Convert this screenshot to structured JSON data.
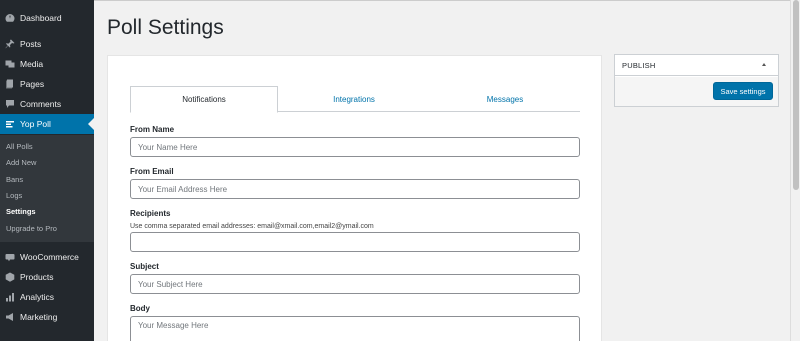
{
  "sidebar": {
    "items": [
      {
        "label": "Dashboard",
        "icon": "dashboard-icon"
      },
      {
        "label": "Posts",
        "icon": "pin-icon"
      },
      {
        "label": "Media",
        "icon": "media-icon"
      },
      {
        "label": "Pages",
        "icon": "pages-icon"
      },
      {
        "label": "Comments",
        "icon": "comments-icon"
      },
      {
        "label": "Yop Poll",
        "icon": "poll-icon",
        "active": true
      },
      {
        "label": "WooCommerce",
        "icon": "woocommerce-icon"
      },
      {
        "label": "Products",
        "icon": "products-icon"
      },
      {
        "label": "Analytics",
        "icon": "analytics-icon"
      },
      {
        "label": "Marketing",
        "icon": "marketing-icon"
      }
    ],
    "submenu": [
      {
        "label": "All Polls"
      },
      {
        "label": "Add New"
      },
      {
        "label": "Bans"
      },
      {
        "label": "Logs"
      },
      {
        "label": "Settings",
        "current": true
      },
      {
        "label": "Upgrade to Pro"
      }
    ]
  },
  "page": {
    "title": "Poll Settings"
  },
  "tabs": [
    {
      "label": "Notifications",
      "active": true
    },
    {
      "label": "Integrations"
    },
    {
      "label": "Messages"
    }
  ],
  "form": {
    "from_name": {
      "label": "From Name",
      "placeholder": "Your Name Here"
    },
    "from_email": {
      "label": "From Email",
      "placeholder": "Your Email Address Here"
    },
    "recipients": {
      "label": "Recipients",
      "help": "Use comma separated email addresses: email@xmail.com,email2@ymail.com",
      "placeholder": ""
    },
    "subject": {
      "label": "Subject",
      "placeholder": "Your Subject Here"
    },
    "body": {
      "label": "Body",
      "placeholder": "Your Message Here"
    }
  },
  "publish": {
    "title": "PUBLISH",
    "save_label": "Save settings"
  },
  "colors": {
    "sidebar_bg": "#23282d",
    "accent": "#0073aa",
    "page_bg": "#f1f1f1"
  }
}
